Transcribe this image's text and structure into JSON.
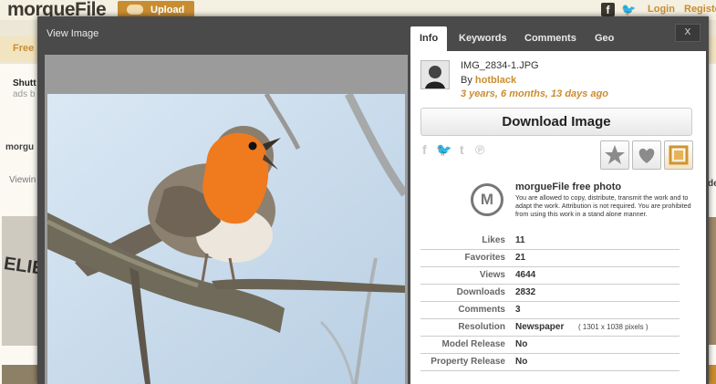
{
  "site": {
    "logo": "morgueFile",
    "upload_label": "Upload",
    "login": "Login",
    "register": "Registe",
    "band_free": "Free",
    "bg_shutt": "Shutt",
    "bg_ads": "ads b",
    "bg_morgu": "morgu",
    "bg_viewin": "Viewin",
    "bg_de": "de",
    "bg_relie": "ELIE"
  },
  "modal": {
    "title": "View Image",
    "close_label": "X"
  },
  "tabs": [
    "Info",
    "Keywords",
    "Comments",
    "Geo"
  ],
  "info": {
    "filename": "IMG_2834-1.JPG",
    "by_prefix": "By",
    "author": "hotblack",
    "ago": "3 years, 6 months, 13 days ago",
    "download_label": "Download Image",
    "share_icons": [
      "facebook-icon",
      "twitter-icon",
      "tumblr-icon",
      "pinterest-icon"
    ],
    "license_logo": "M",
    "license_title": "morgueFile free photo",
    "license_text": "You are allowed to copy, distribute, transmit the work and to adapt the work. Attribution is not required. You are prohibited from using this work in a stand alone manner."
  },
  "stats": [
    {
      "label": "Likes",
      "value": "11"
    },
    {
      "label": "Favorites",
      "value": "21"
    },
    {
      "label": "Views",
      "value": "4644"
    },
    {
      "label": "Downloads",
      "value": "2832"
    },
    {
      "label": "Comments",
      "value": "3"
    },
    {
      "label": "Resolution",
      "value": "Newspaper",
      "sub": "( 1301 x 1038 pixels )"
    },
    {
      "label": "Model Release",
      "value": "No"
    },
    {
      "label": "Property Release",
      "value": "No"
    }
  ],
  "colors": {
    "accent": "#c98d31",
    "modal_bg": "#4a4a4a",
    "robin_orange": "#f07a1e"
  }
}
